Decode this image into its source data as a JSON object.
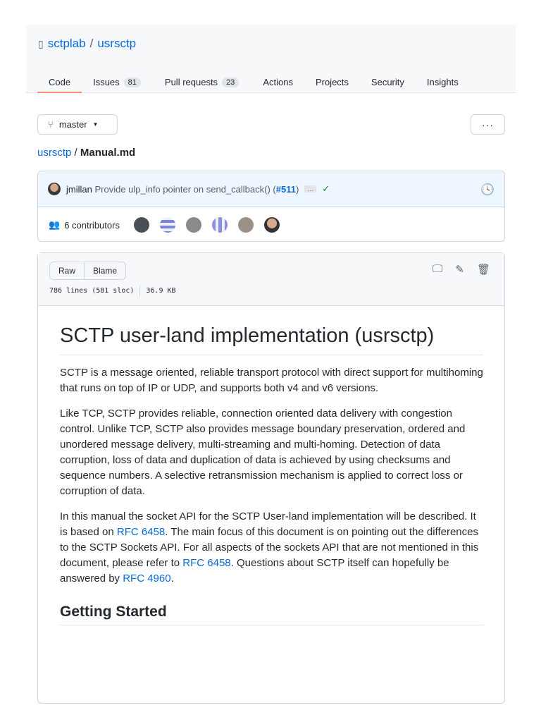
{
  "repo": {
    "owner": "sctplab",
    "name": "usrsctp"
  },
  "tabs": [
    {
      "label": "Code"
    },
    {
      "label": "Issues",
      "count": "81"
    },
    {
      "label": "Pull requests",
      "count": "23"
    },
    {
      "label": "Actions"
    },
    {
      "label": "Projects"
    },
    {
      "label": "Security"
    },
    {
      "label": "Insights"
    }
  ],
  "branch": "master",
  "more": "···",
  "breadcrumb": {
    "repo": "usrsctp",
    "sep": "/",
    "file": "Manual.md"
  },
  "commit": {
    "author": "jmillan",
    "message": "Provide ulp_info pointer on send_callback() (",
    "pr": "#511",
    "close": ")",
    "ellipsis": "…",
    "check": "✓"
  },
  "contributors": "6 contributors",
  "file": {
    "raw": "Raw",
    "blame": "Blame",
    "lines": "786 lines (581 sloc)",
    "size": "36.9 KB"
  },
  "doc": {
    "title": "SCTP user-land implementation (usrsctp)",
    "p1": "SCTP is a message oriented, reliable transport protocol with direct support for multihoming that runs on top of IP or UDP, and supports both v4 and v6 versions.",
    "p2": "Like TCP, SCTP provides reliable, connection oriented data delivery with congestion control. Unlike TCP, SCTP also provides message boundary preservation, ordered and unordered message delivery, multi-streaming and multi-homing. Detection of data corruption, loss of data and duplication of data is achieved by using checksums and sequence numbers. A selective retransmission mechanism is applied to correct loss or corruption of data.",
    "p3": [
      "In this manual the socket API for the SCTP User-land implementation will be described. It is based on ",
      "RFC 6458",
      ". The main focus of this document is on pointing out the differences to the SCTP Sockets API. For all aspects of the sockets API that are not mentioned in this document, please refer to ",
      "RFC 6458",
      ". Questions about SCTP itself can hopefully be answered by ",
      "RFC 4960",
      "."
    ],
    "h2": "Getting Started"
  }
}
